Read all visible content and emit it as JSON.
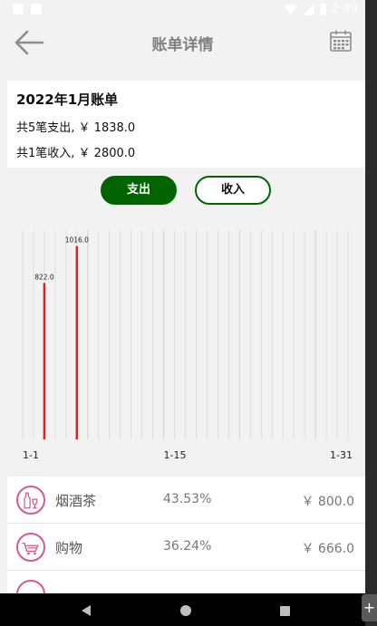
{
  "status_bar": {
    "time": "2:49"
  },
  "header": {
    "title": "账单详情"
  },
  "summary": {
    "month_title": "2022年1月账单",
    "expense_line": "共5笔支出, ￥ 1838.0",
    "income_line": "共1笔收入, ￥ 2800.0"
  },
  "toggle": {
    "expense_label": "支出",
    "income_label": "收入",
    "selected": "支出"
  },
  "chart_data": {
    "type": "bar",
    "x_range": [
      1,
      31
    ],
    "x_tick_labels": [
      "1-1",
      "1-15",
      "1-31"
    ],
    "ylim": [
      0,
      1100
    ],
    "points": [
      {
        "x": 3,
        "value": 822.0,
        "label": "822.0"
      },
      {
        "x": 6,
        "value": 1016.0,
        "label": "1016.0"
      }
    ],
    "grid": true,
    "bar_color": "#e31c1c",
    "grid_color": "#d6d6d6"
  },
  "categories": [
    {
      "name": "烟酒茶",
      "percent": "43.53%",
      "amount": "￥ 800.0",
      "icon": "wine-bottle-icon"
    },
    {
      "name": "购物",
      "percent": "36.24%",
      "amount": "￥ 666.0",
      "icon": "shopping-cart-icon"
    },
    {
      "name": "",
      "percent": "",
      "amount": "",
      "icon": "category-icon"
    }
  ],
  "colors": {
    "accent": "#006400",
    "category_icon": "#d35a94"
  }
}
